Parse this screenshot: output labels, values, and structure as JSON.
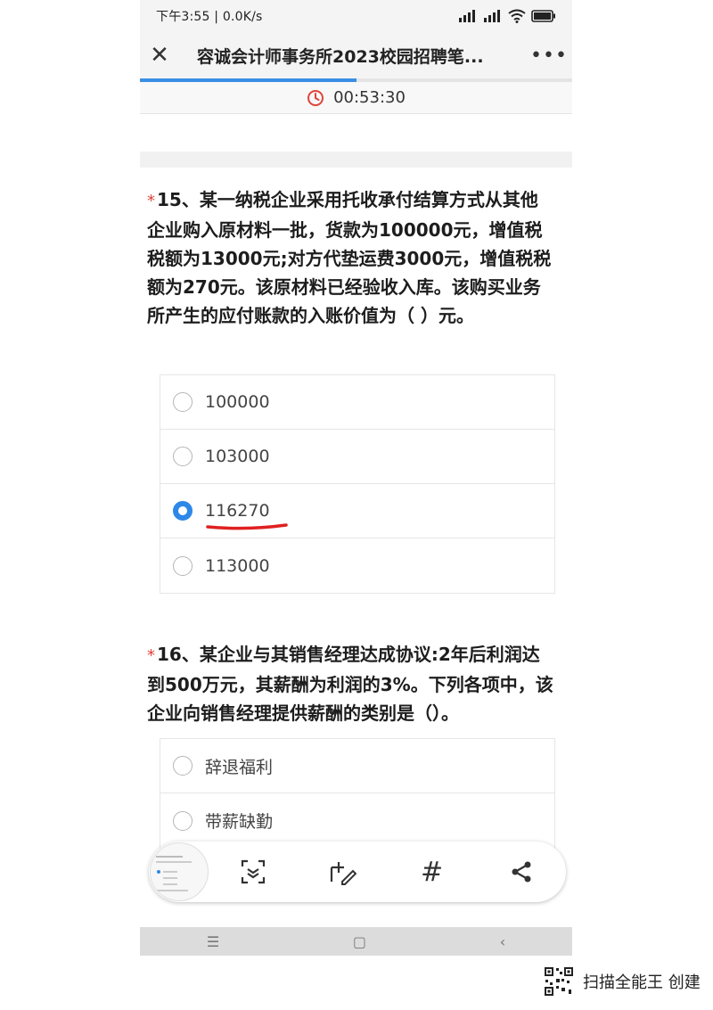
{
  "status": {
    "time_speed": "下午3:55 | 0.0K/s"
  },
  "header": {
    "title": "容诚会计师事务所2023校园招聘笔..."
  },
  "timer": {
    "value": "00:53:30"
  },
  "progress": {
    "fraction": 0.5
  },
  "q15": {
    "star": "*",
    "text": "15、某一纳税企业采用托收承付结算方式从其他企业购入原材料一批，货款为100000元，增值税税额为13000元;对方代垫运费3000元，增值税税额为270元。该原材料已经验收入库。该购买业务所产生的应付账款的入账价值为（ ）元。",
    "options": [
      "100000",
      "103000",
      "116270",
      "113000"
    ],
    "selected_index": 2
  },
  "q16": {
    "star": "*",
    "text": "16、某企业与其销售经理达成协议:2年后利润达到500万元，其薪酬为利润的3%。下列各项中，该企业向销售经理提供薪酬的类别是（）。",
    "options": [
      "辞退福利",
      "带薪缺勤"
    ]
  },
  "watermark": {
    "text": "扫描全能王 创建"
  },
  "colors": {
    "accent": "#2d88e8",
    "required_star": "#e0443b",
    "annotation": "#e02020"
  }
}
